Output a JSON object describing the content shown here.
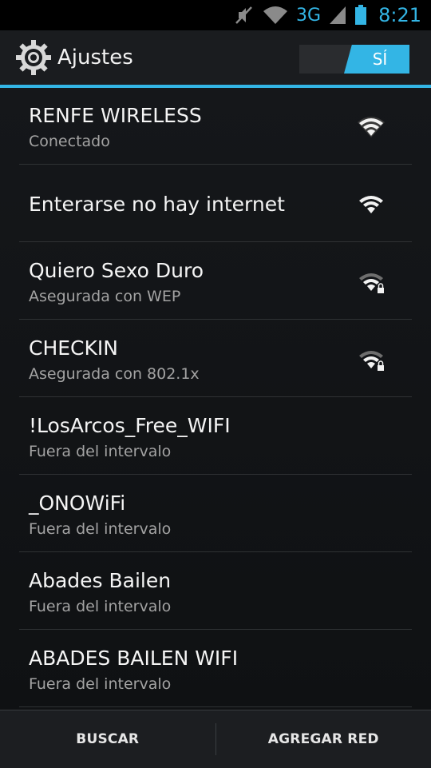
{
  "status_bar": {
    "network_type": "3G",
    "time": "8:21",
    "icons": [
      "sound-muted-icon",
      "wifi-icon",
      "signal-icon",
      "battery-icon"
    ],
    "accent_color": "#33b5e5"
  },
  "action_bar": {
    "title": "Ajustes",
    "icon": "settings-gear-icon",
    "toggle_label": "SÍ"
  },
  "networks": [
    {
      "name": "RENFE WIRELESS",
      "status": "Conectado",
      "secured": false
    },
    {
      "name": "Enterarse no hay internet",
      "status": "",
      "secured": false
    },
    {
      "name": "Quiero Sexo Duro",
      "status": "Asegurada con WEP",
      "secured": true
    },
    {
      "name": "CHECKIN",
      "status": "Asegurada con 802.1x",
      "secured": true
    },
    {
      "name": "!LosArcos_Free_WIFI",
      "status": "Fuera del intervalo",
      "secured": false
    },
    {
      "name": "_ONOWiFi",
      "status": "Fuera del intervalo",
      "secured": false
    },
    {
      "name": "Abades Bailen",
      "status": "Fuera del intervalo",
      "secured": false
    },
    {
      "name": "ABADES BAILEN WIFI",
      "status": "Fuera del intervalo",
      "secured": false
    }
  ],
  "bottom_bar": {
    "scan_label": "BUSCAR",
    "add_network_label": "AGREGAR RED"
  }
}
